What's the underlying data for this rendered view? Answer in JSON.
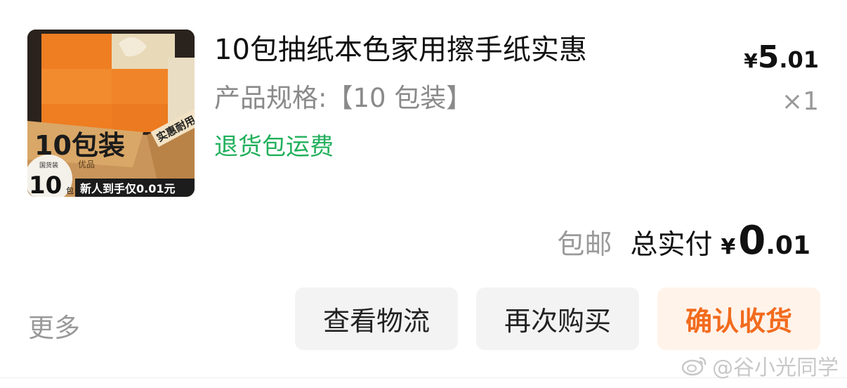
{
  "product": {
    "title": "10包抽纸本色家用擦手纸实惠",
    "spec": "产品规格:【10 包装】",
    "return_tag": "退货包运费",
    "image": {
      "big_text": "10包装",
      "side_text": "实惠耐用",
      "badge_top": "国货装",
      "badge_num": "10",
      "badge_unit": "包",
      "promo": "新人到手仅0.01元",
      "box_label": "优品"
    }
  },
  "price": {
    "currency": "¥",
    "integer": "5",
    "decimal": ".01"
  },
  "quantity": "×1",
  "summary": {
    "shipping": "包邮",
    "total_label": "总实付",
    "currency": "¥",
    "integer": "0",
    "decimal": ".01"
  },
  "actions": {
    "more": "更多",
    "logistics": "查看物流",
    "rebuy": "再次购买",
    "confirm": "确认收货"
  },
  "watermark": "@谷小光同学",
  "colors": {
    "accent": "#f26b1d",
    "green": "#21b05c"
  }
}
